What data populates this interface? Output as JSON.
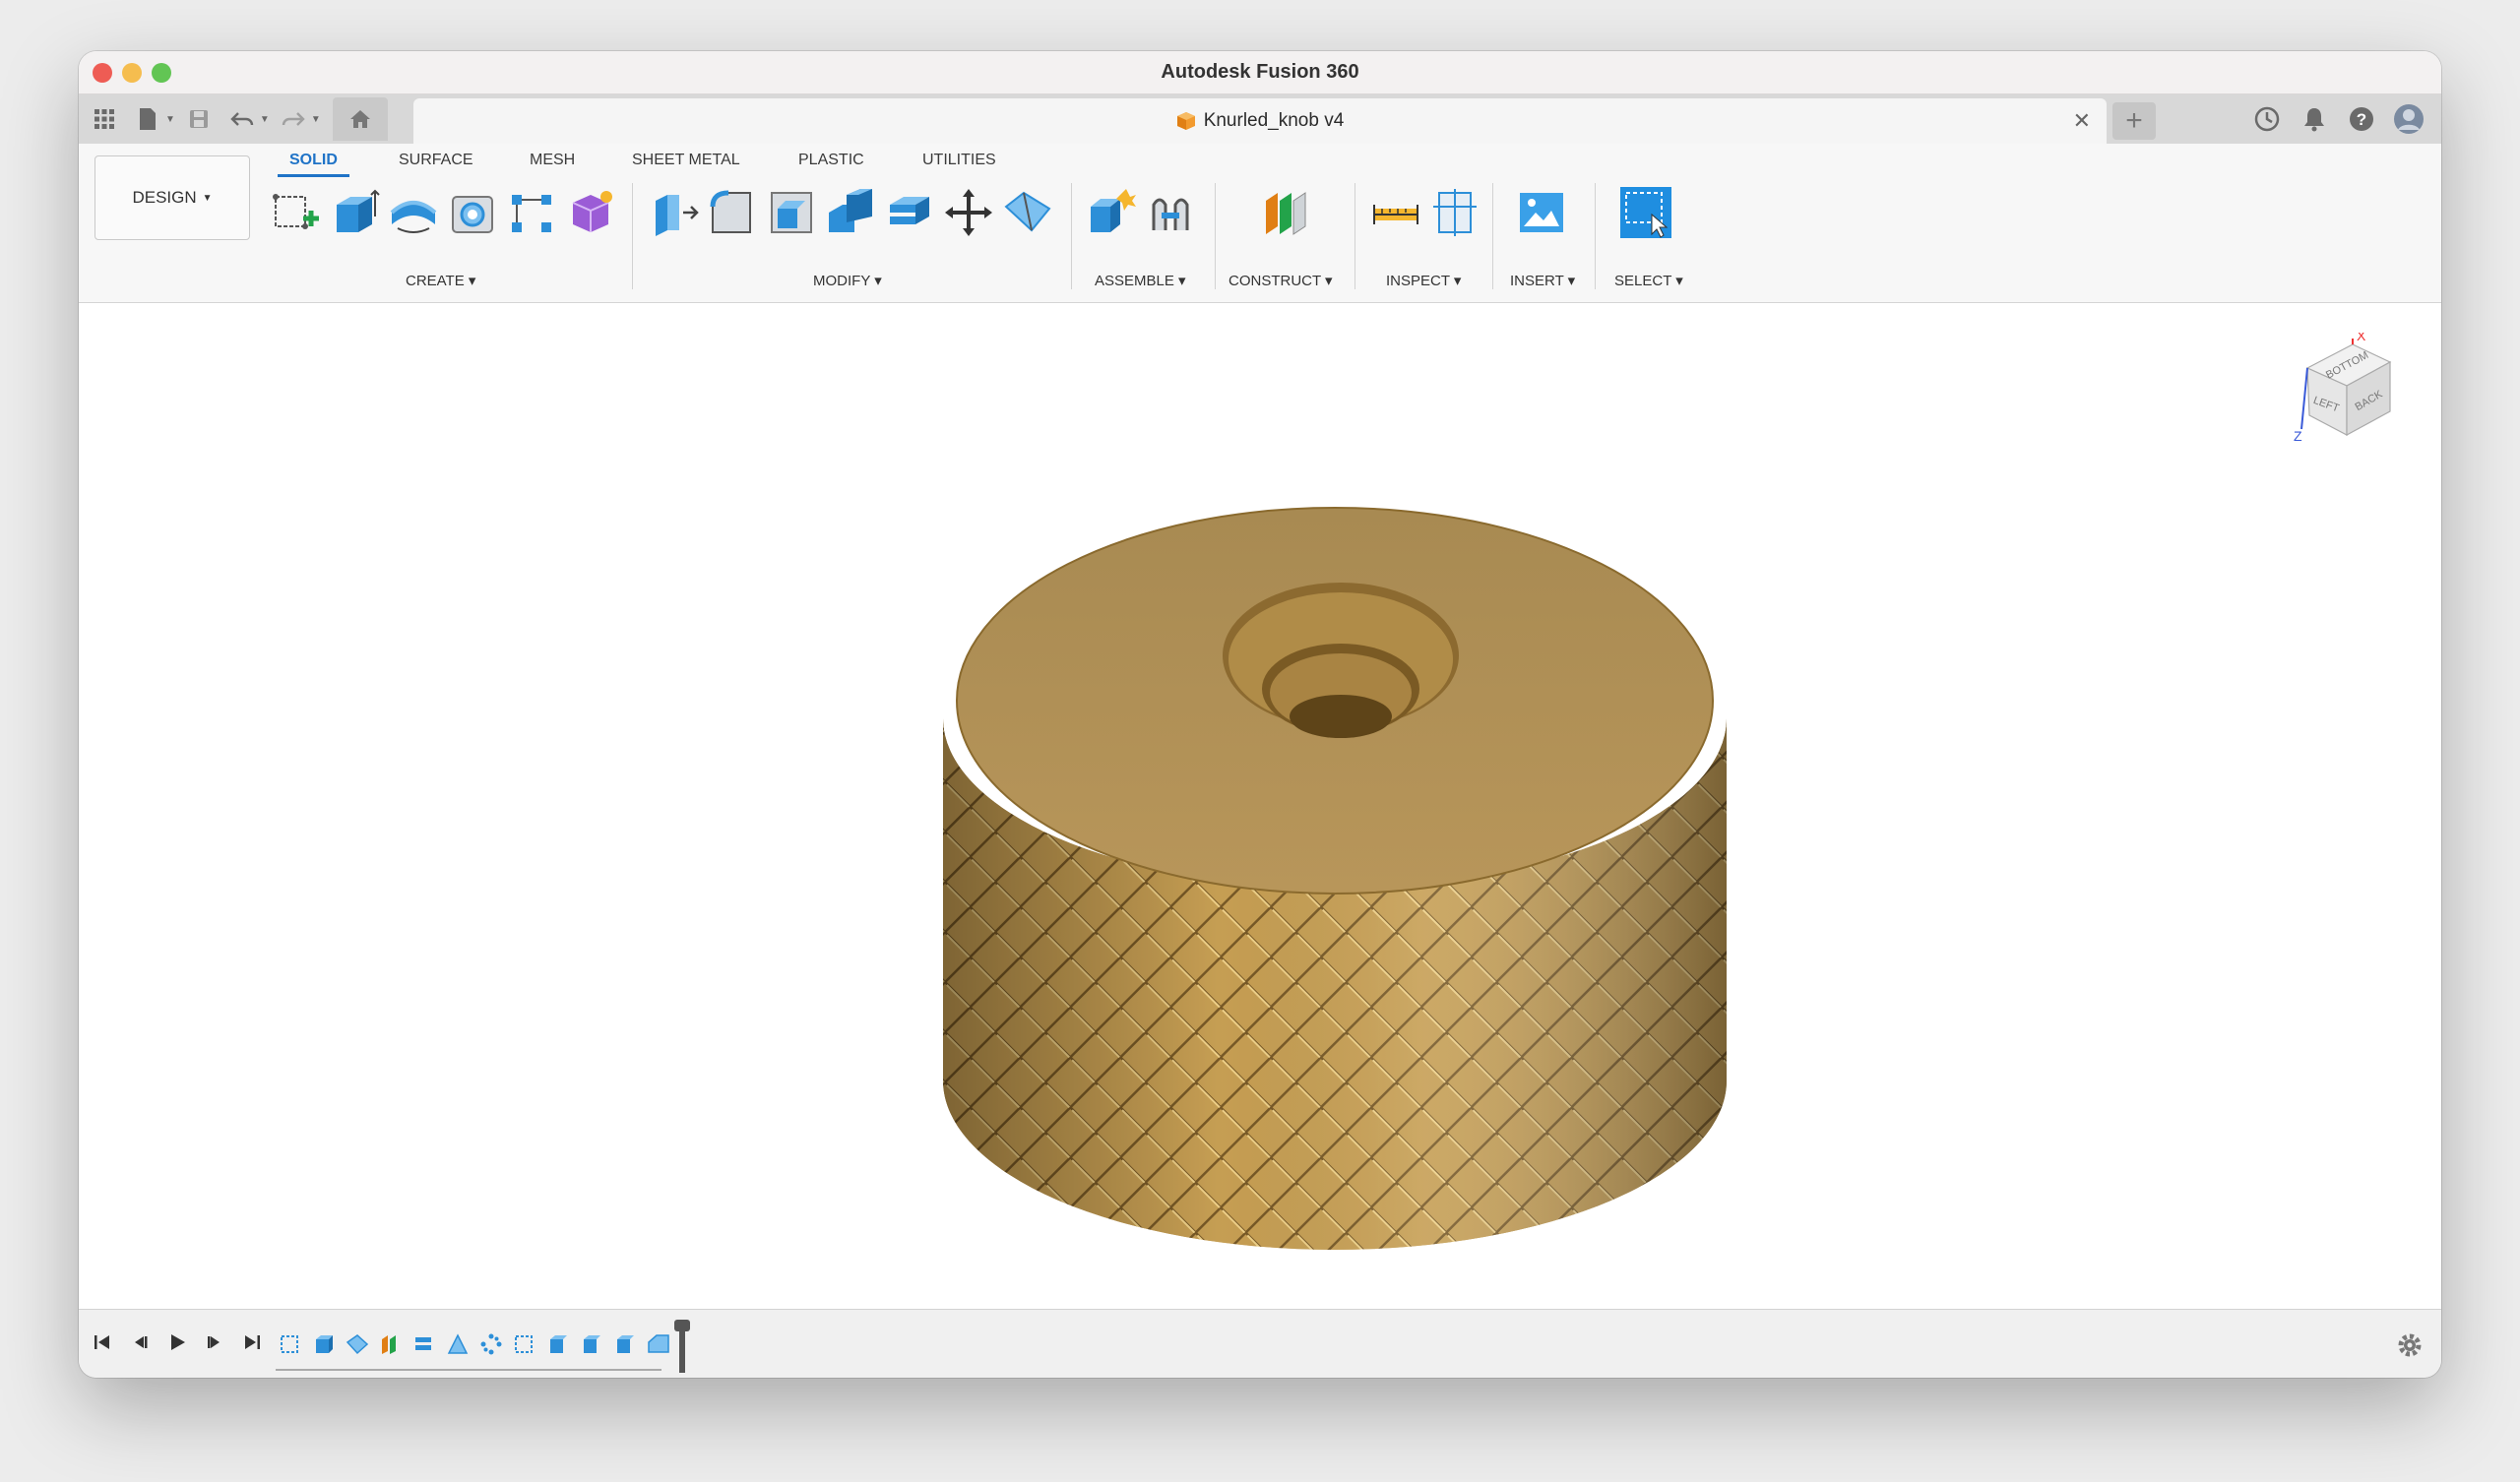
{
  "window": {
    "title": "Autodesk Fusion 360",
    "traffic_colors": [
      "#ee5c54",
      "#f5bd4f",
      "#62c554"
    ]
  },
  "tabbar": {
    "document_name": "Knurled_knob v4",
    "icons": [
      "apps-grid-icon",
      "file-icon",
      "save-icon",
      "undo-icon",
      "redo-icon",
      "home-icon",
      "close-icon",
      "new-tab-icon",
      "job-status-icon",
      "notifications-icon",
      "help-icon",
      "user-avatar"
    ]
  },
  "ribbon": {
    "workspace": "DESIGN",
    "tabs": [
      "SOLID",
      "SURFACE",
      "MESH",
      "SHEET METAL",
      "PLASTIC",
      "UTILITIES"
    ],
    "active_tab": "SOLID",
    "groups": {
      "create": "CREATE",
      "modify": "MODIFY",
      "assemble": "ASSEMBLE",
      "construct": "CONSTRUCT",
      "inspect": "INSPECT",
      "insert": "INSERT",
      "select": "SELECT"
    },
    "accent": "#1f73c7"
  },
  "viewcube": {
    "faces": [
      "BOTTOM",
      "LEFT",
      "BACK"
    ],
    "axes": [
      "X",
      "Z"
    ]
  },
  "model": {
    "name": "knurled knob",
    "color": "#b0935a"
  },
  "navbar": {
    "icons": [
      "orbit-icon",
      "look-at-icon",
      "pan-icon",
      "zoom-icon",
      "fit-icon",
      "display-settings-icon",
      "visual-style-icon",
      "grid-icon"
    ]
  },
  "timeline": {
    "controls": [
      "go-to-start",
      "step-back",
      "play",
      "step-forward",
      "go-to-end"
    ],
    "feature_count": 13
  }
}
